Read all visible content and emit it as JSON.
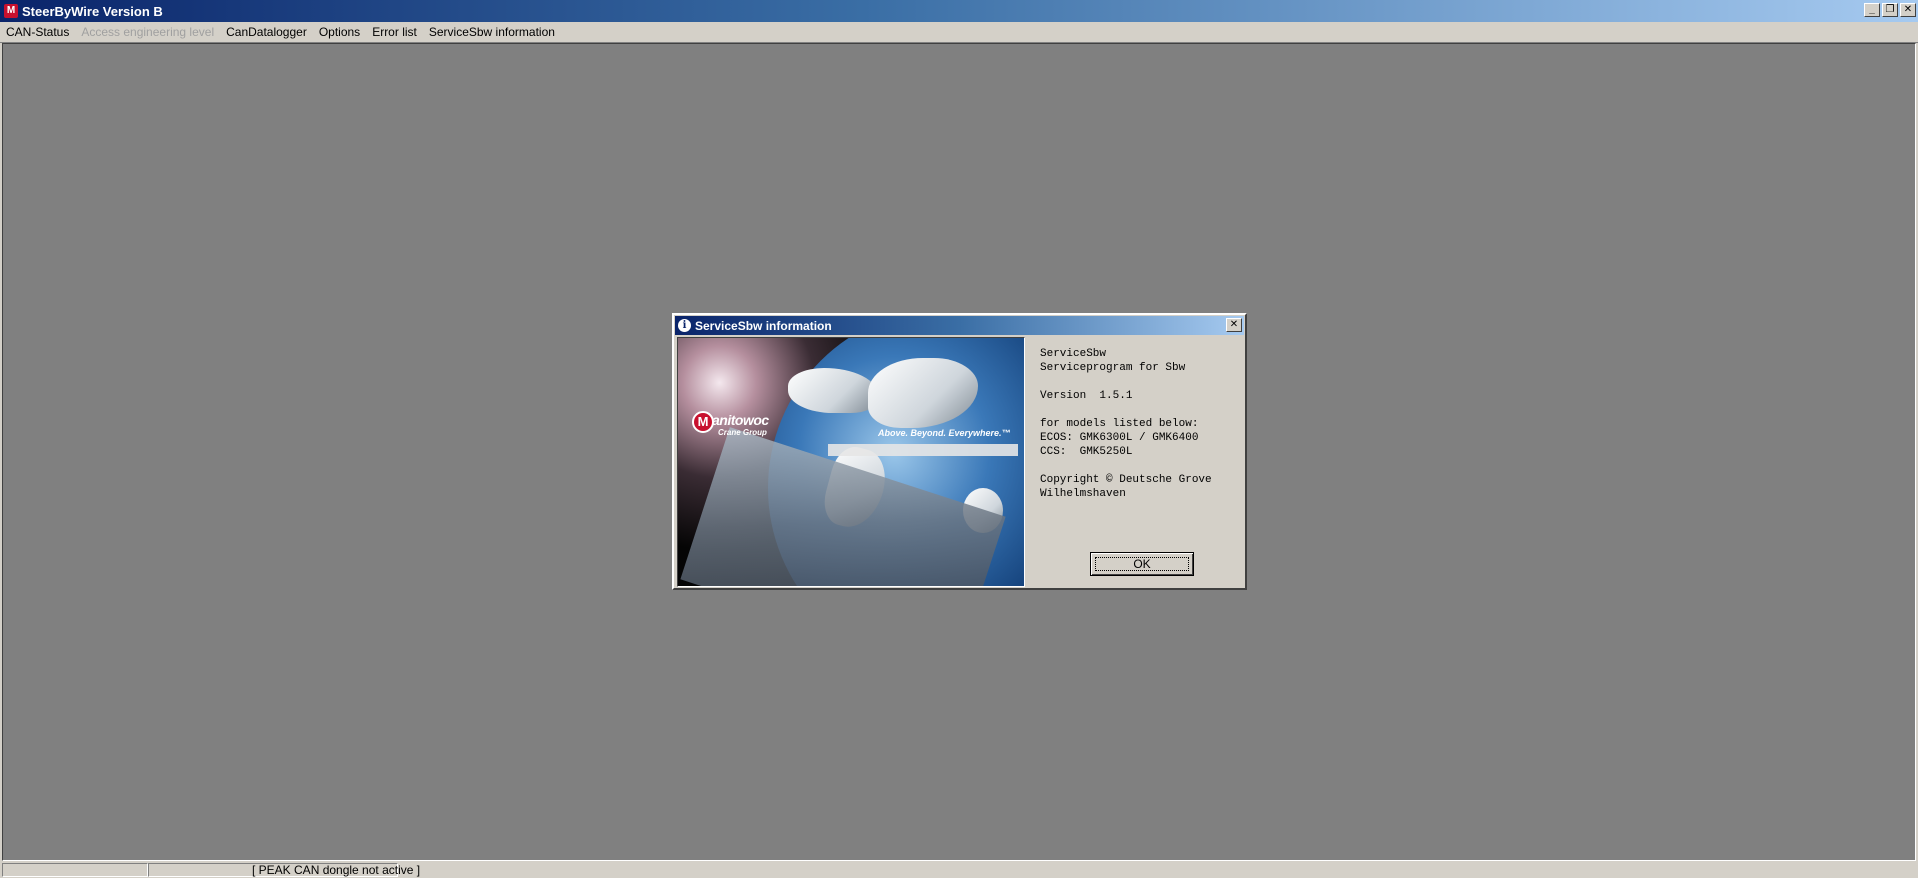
{
  "window": {
    "title": "SteerByWire Version B",
    "icon": "app-logo-icon",
    "controls": {
      "minimize": "_",
      "restore": "❐",
      "close": "✕"
    }
  },
  "menu": {
    "items": [
      {
        "label": "CAN-Status",
        "enabled": true
      },
      {
        "label": "Access engineering level",
        "enabled": false
      },
      {
        "label": "CanDatalogger",
        "enabled": true
      },
      {
        "label": "Options",
        "enabled": true
      },
      {
        "label": "Error list",
        "enabled": true
      },
      {
        "label": "ServiceSbw information",
        "enabled": true
      }
    ]
  },
  "status_bar": {
    "message": "[ PEAK CAN dongle not active ]"
  },
  "dialog": {
    "title": "ServiceSbw information",
    "icon": "info-icon",
    "close_glyph": "✕",
    "image": {
      "logo_initial": "M",
      "logo_name": "anitowoc",
      "logo_sub": "Crane Group",
      "slogan": "Above. Beyond. Everywhere.™"
    },
    "info_text": "ServiceSbw\nServiceprogram for Sbw\n\nVersion  1.5.1\n\nfor models listed below:\nECOS: GMK6300L / GMK6400\nCCS:  GMK5250L\n\nCopyright © Deutsche Grove\nWilhelmshaven",
    "ok_label": "OK"
  },
  "colors": {
    "title_bar_start": "#0a246a",
    "title_bar_end": "#a6caf0",
    "face": "#d4d0c8",
    "mdi_background": "#808080",
    "brand_red": "#c8102e"
  }
}
